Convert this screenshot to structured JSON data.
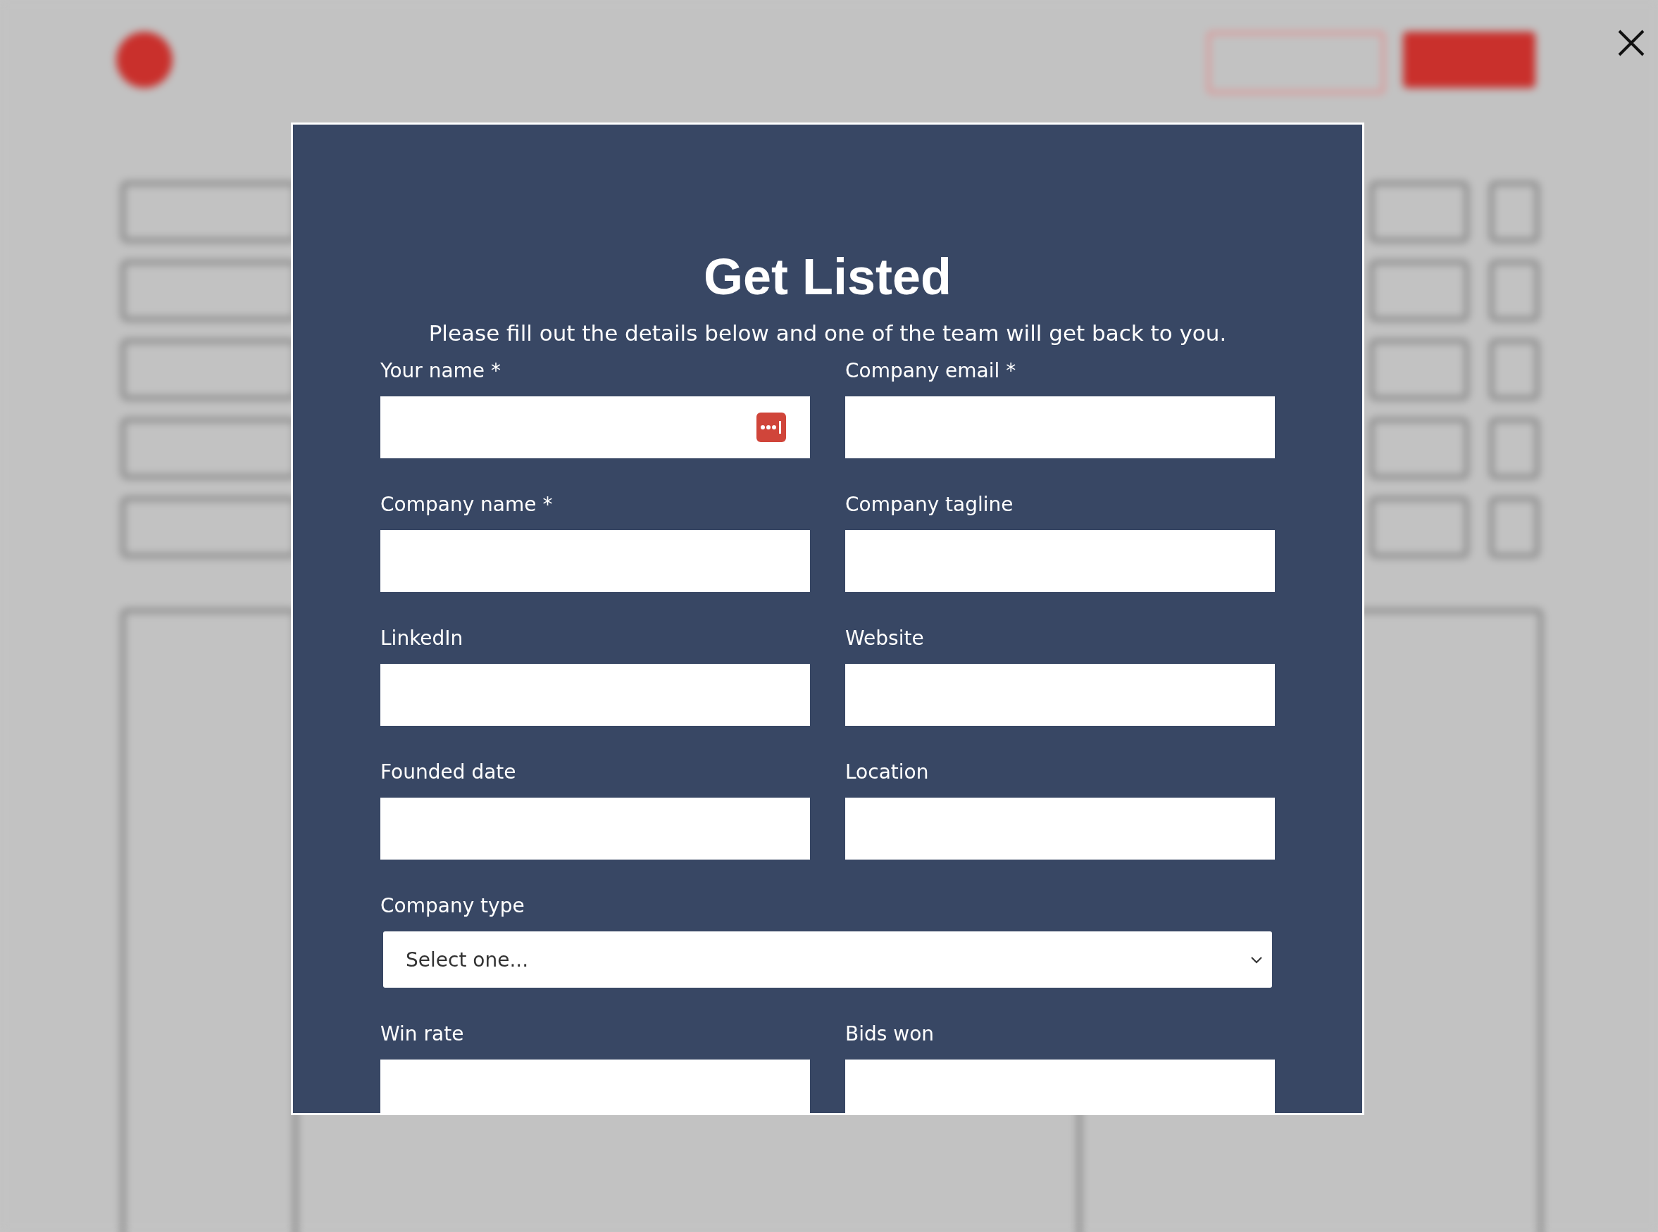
{
  "modal": {
    "title": "Get Listed",
    "subtitle": "Please fill out the details below and one of the team will get back to you.",
    "fields": [
      {
        "kind": "text",
        "label": "Your name *",
        "password_manager": true
      },
      {
        "kind": "text",
        "label": "Company email *"
      },
      {
        "kind": "text",
        "label": "Company name *"
      },
      {
        "kind": "text",
        "label": "Company tagline"
      },
      {
        "kind": "text",
        "label": "LinkedIn"
      },
      {
        "kind": "text",
        "label": "Website"
      },
      {
        "kind": "text",
        "label": "Founded date"
      },
      {
        "kind": "text",
        "label": "Location"
      },
      {
        "kind": "select",
        "label": "Company type",
        "value": "Select one..."
      },
      {
        "kind": "text",
        "label": "Win rate"
      },
      {
        "kind": "text",
        "label": "Bids won"
      }
    ]
  }
}
